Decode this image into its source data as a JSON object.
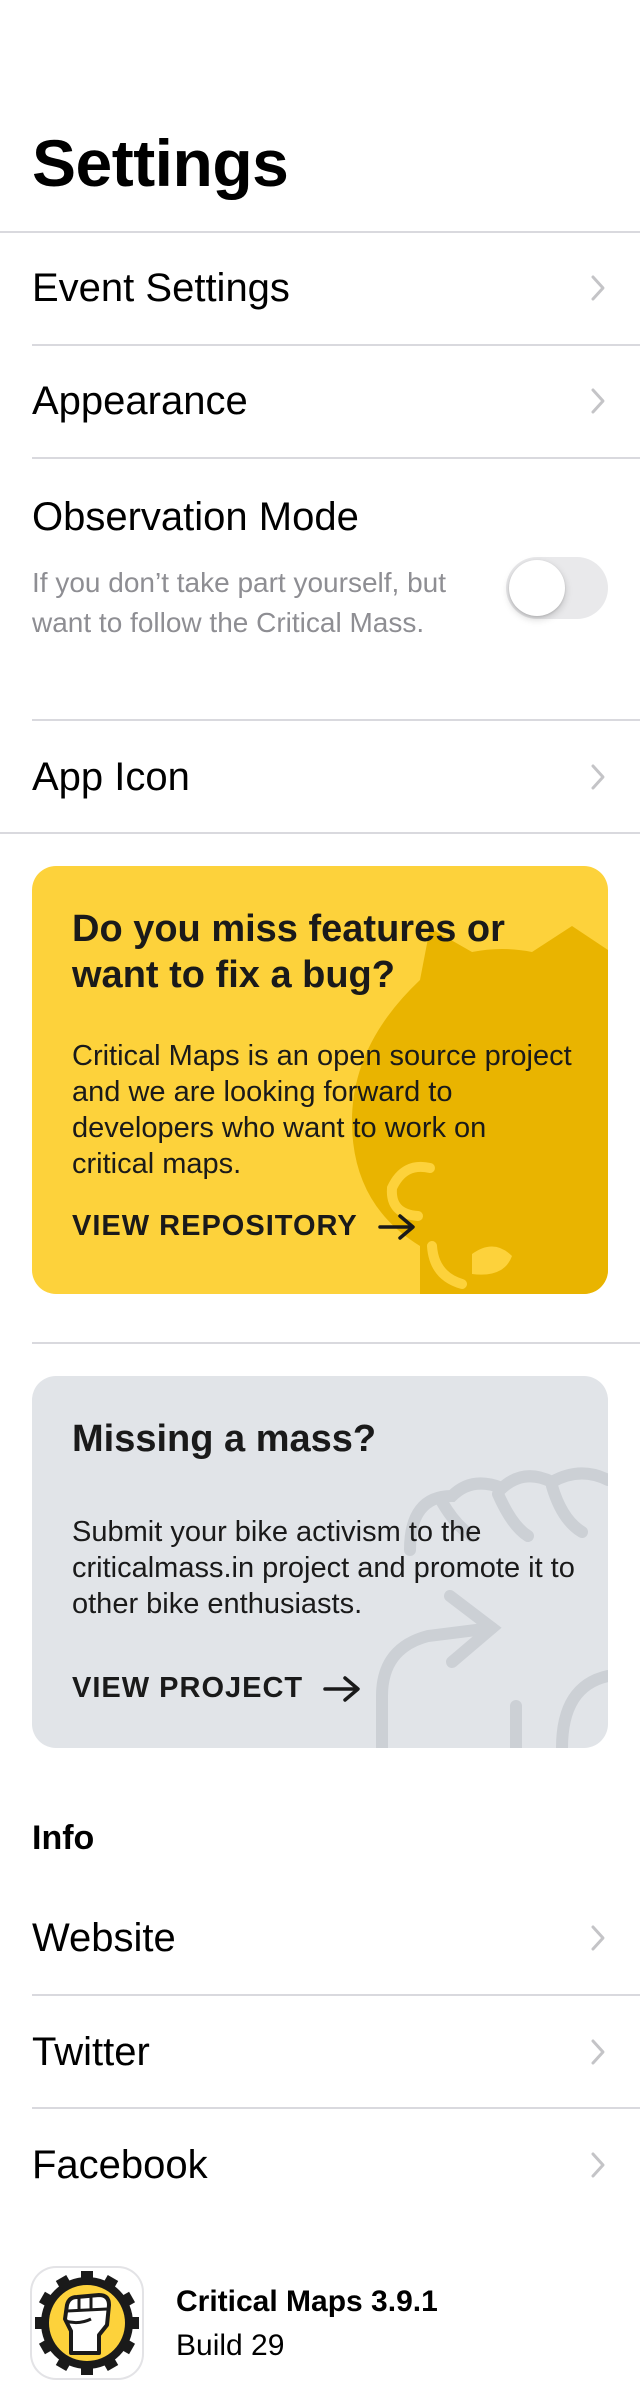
{
  "page": {
    "title": "Settings"
  },
  "rows": {
    "event_settings": "Event Settings",
    "appearance": "Appearance",
    "app_icon": "App Icon"
  },
  "observation": {
    "title": "Observation Mode",
    "description": "If you don’t take part yourself, but want to follow the Critical Mass.",
    "enabled": false
  },
  "repo_card": {
    "title": "Do you miss features or want to fix a bug?",
    "body": "Critical Maps is an open source project and we are looking forward to developers who want to work on critical maps.",
    "link": "VIEW REPOSITORY",
    "color": "#fdd23b"
  },
  "project_card": {
    "title": "Missing a mass?",
    "body": "Submit your bike activism to the criticalmass.in project and promote it to other bike enthusiasts.",
    "link": "VIEW PROJECT",
    "color": "#e1e4e8"
  },
  "info": {
    "header": "Info",
    "items": [
      {
        "label": "Website"
      },
      {
        "label": "Twitter"
      },
      {
        "label": "Facebook"
      }
    ]
  },
  "app": {
    "name": "Critical Maps 3.9.1",
    "build": "Build 29"
  }
}
